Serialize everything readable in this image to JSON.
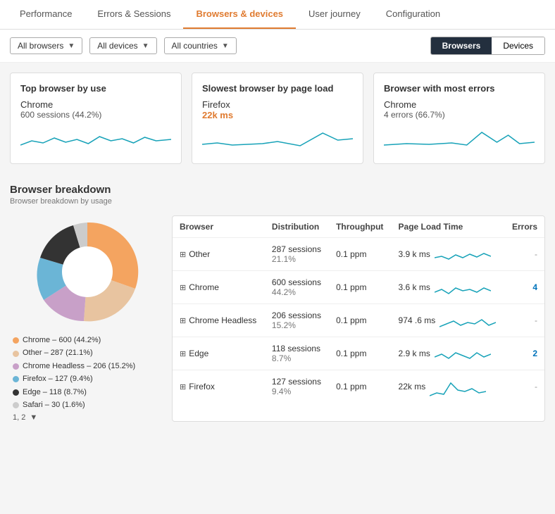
{
  "tabs": [
    {
      "label": "Performance",
      "active": false
    },
    {
      "label": "Errors & Sessions",
      "active": false
    },
    {
      "label": "Browsers & devices",
      "active": true
    },
    {
      "label": "User journey",
      "active": false
    },
    {
      "label": "Configuration",
      "active": false
    }
  ],
  "filters": [
    {
      "label": "All browsers",
      "value": "all-browsers"
    },
    {
      "label": "All devices",
      "value": "all-devices"
    },
    {
      "label": "All countries",
      "value": "all-countries"
    }
  ],
  "viewToggle": {
    "browsers_label": "Browsers",
    "devices_label": "Devices"
  },
  "summaryCards": [
    {
      "title": "Top browser by use",
      "browser": "Chrome",
      "metric": "600 sessions (44.2%)",
      "metricColor": "normal"
    },
    {
      "title": "Slowest browser by page load",
      "browser": "Firefox",
      "metric": "22k ms",
      "metricColor": "orange"
    },
    {
      "title": "Browser with most errors",
      "browser": "Chrome",
      "metric": "4 errors (66.7%)",
      "metricColor": "normal"
    }
  ],
  "breakdown": {
    "title": "Browser breakdown",
    "subtitle": "Browser breakdown by usage",
    "legend": [
      {
        "label": "Chrome – 600 (44.2%)",
        "color": "#f4a460"
      },
      {
        "label": "Other – 287 (21.1%)",
        "color": "#e8c4a0"
      },
      {
        "label": "Chrome Headless – 206 (15.2%)",
        "color": "#c8a0c8"
      },
      {
        "label": "Firefox – 127 (9.4%)",
        "color": "#6bb5d6"
      },
      {
        "label": "Edge – 118 (8.7%)",
        "color": "#333"
      },
      {
        "label": "Safari – 30 (1.6%)",
        "color": "#ccc"
      }
    ],
    "navLabel": "1, 2"
  },
  "tableHeaders": [
    "Browser",
    "Distribution",
    "Throughput",
    "Page Load Time",
    "Errors"
  ],
  "tableRows": [
    {
      "browser": "Other",
      "sessions": "287 sessions",
      "pct": "21.1%",
      "throughput": "0.1 ppm",
      "loadTime": "3.9 k ms",
      "errors": "-"
    },
    {
      "browser": "Chrome",
      "sessions": "600 sessions",
      "pct": "44.2%",
      "throughput": "0.1 ppm",
      "loadTime": "3.6 k ms",
      "errors": "4"
    },
    {
      "browser": "Chrome Headless",
      "sessions": "206 sessions",
      "pct": "15.2%",
      "throughput": "0.1 ppm",
      "loadTime": "974 .6 ms",
      "errors": "-"
    },
    {
      "browser": "Edge",
      "sessions": "118 sessions",
      "pct": "8.7%",
      "throughput": "0.1 ppm",
      "loadTime": "2.9 k ms",
      "errors": "2"
    },
    {
      "browser": "Firefox",
      "sessions": "127 sessions",
      "pct": "9.4%",
      "throughput": "0.1 ppm",
      "loadTime": "22k ms",
      "errors": "-"
    }
  ]
}
